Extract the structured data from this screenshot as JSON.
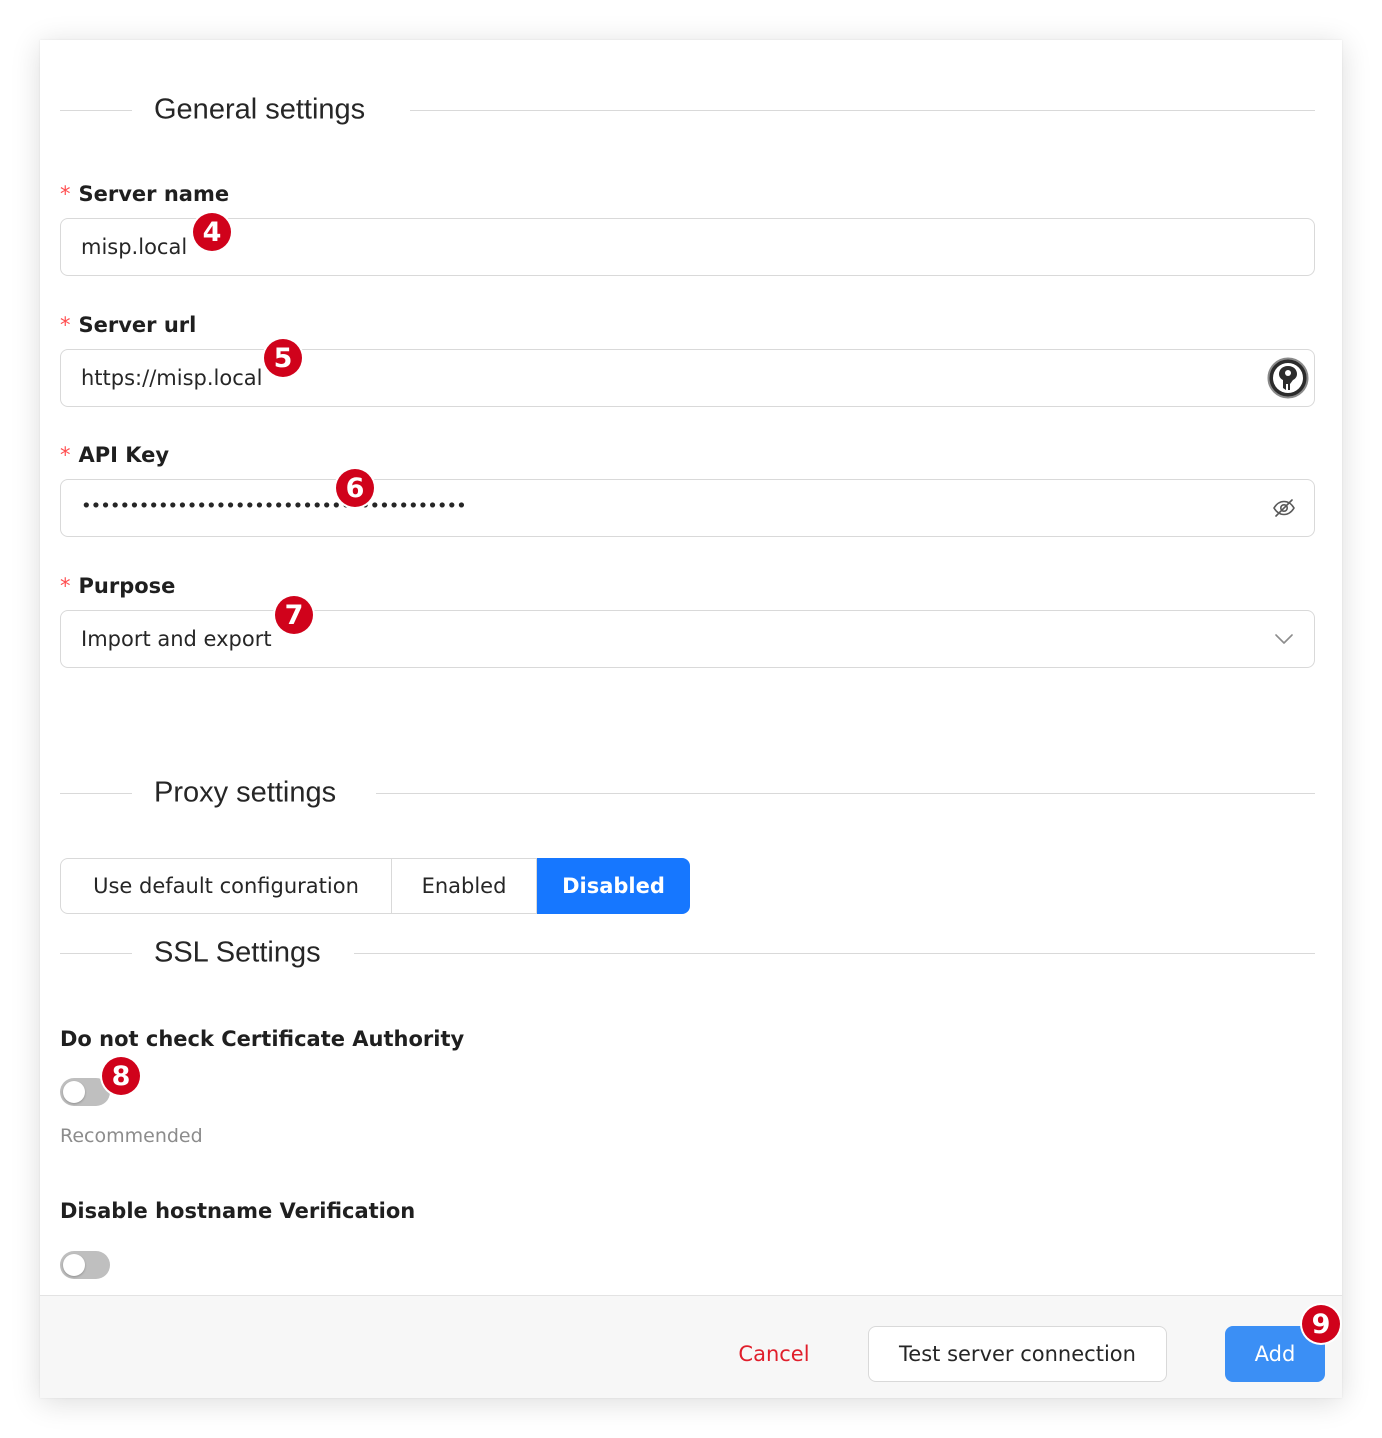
{
  "general": {
    "title": "General settings",
    "server_name": {
      "label": "Server name",
      "value": "misp.local",
      "required": "*"
    },
    "server_url": {
      "label": "Server url",
      "value": "https://misp.local",
      "required": "*"
    },
    "api_key": {
      "label": "API Key",
      "value": "••••••••••••••••••••••••••••••••••••••••",
      "required": "*"
    },
    "purpose": {
      "label": "Purpose",
      "value": "Import and export",
      "required": "*"
    }
  },
  "proxy": {
    "title": "Proxy settings",
    "options": [
      "Use default configuration",
      "Enabled",
      "Disabled"
    ],
    "selected": "Disabled"
  },
  "ssl": {
    "title": "SSL Settings",
    "ca_check": {
      "label": "Do not check Certificate Authority",
      "help": "Recommended",
      "on": false
    },
    "hostname": {
      "label": "Disable hostname Verification",
      "on": false
    }
  },
  "footer": {
    "cancel": "Cancel",
    "test": "Test server connection",
    "add": "Add"
  },
  "badges": {
    "b4": "4",
    "b5": "5",
    "b6": "6",
    "b7": "7",
    "b8": "8",
    "b9": "9"
  },
  "colors": {
    "primary": "#1677ff",
    "danger": "#e01e2b",
    "badge": "#d0021b"
  },
  "icons": {
    "url_suffix": "password-manager-icon",
    "api_suffix": "eye-invisible-icon",
    "purpose_suffix": "chevron-down-icon"
  }
}
